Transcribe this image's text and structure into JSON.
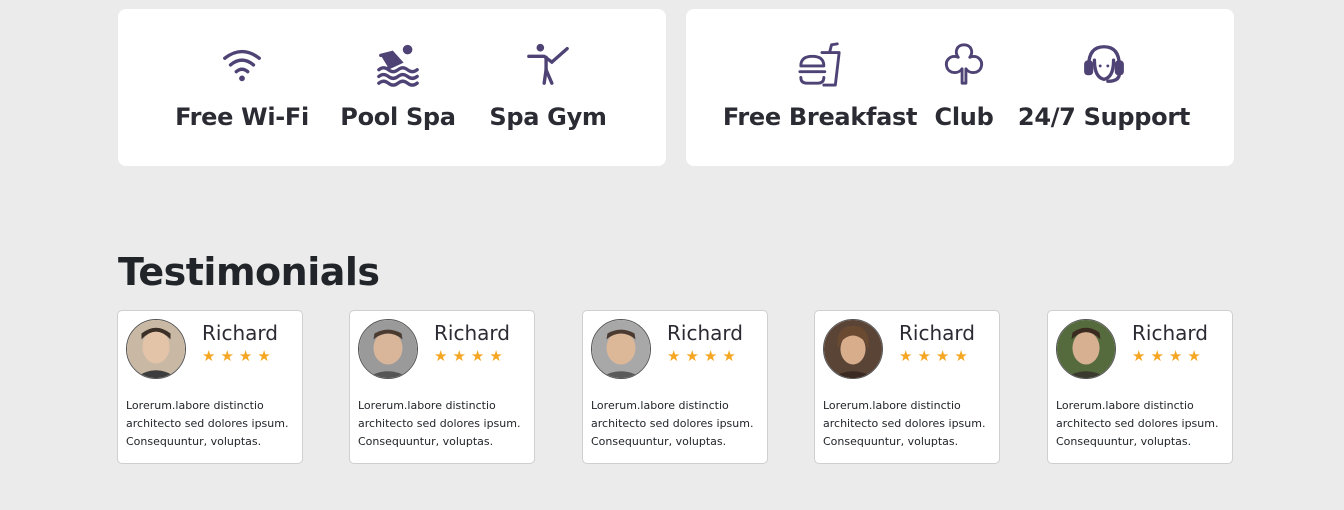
{
  "amenities": {
    "left": [
      {
        "label": "Free Wi-Fi",
        "icon": "wifi-icon"
      },
      {
        "label": "Pool Spa",
        "icon": "swimmer-icon"
      },
      {
        "label": "Spa Gym",
        "icon": "karate-icon"
      }
    ],
    "right": [
      {
        "label": "Free Breakfast",
        "icon": "burger-drink-icon"
      },
      {
        "label": "Club",
        "icon": "club-icon"
      },
      {
        "label": "24/7 Support",
        "icon": "headset-icon"
      }
    ]
  },
  "testimonials": {
    "title": "Testimonials",
    "rating_star": "★",
    "rating": 4,
    "items": [
      {
        "name": "Richard",
        "text": "Lorerum.labore distinctio architecto sed dolores ipsum. Consequuntur, voluptas."
      },
      {
        "name": "Richard",
        "text": "Lorerum.labore distinctio architecto sed dolores ipsum. Consequuntur, voluptas."
      },
      {
        "name": "Richard",
        "text": "Lorerum.labore distinctio architecto sed dolores ipsum. Consequuntur, voluptas."
      },
      {
        "name": "Richard",
        "text": "Lorerum.labore distinctio architecto sed dolores ipsum. Consequuntur, voluptas."
      },
      {
        "name": "Richard",
        "text": "Lorerum.labore distinctio architecto sed dolores ipsum. Consequuntur, voluptas."
      }
    ]
  },
  "colors": {
    "icon": "#4e4374",
    "star": "#f5a623",
    "background": "#ebebeb"
  }
}
